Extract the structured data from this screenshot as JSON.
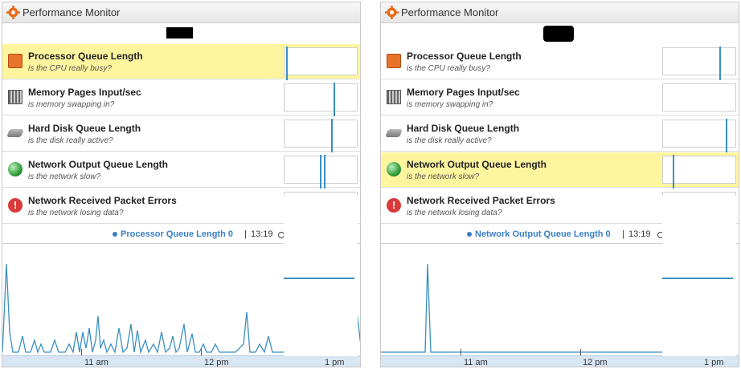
{
  "panels": [
    {
      "title": "Performance Monitor",
      "metrics": [
        {
          "label": "Processor Queue Length",
          "sub": "is the CPU really busy?",
          "icon": "cpu-icon",
          "active": true
        },
        {
          "label": "Memory Pages Input/sec",
          "sub": "is memory swapping in?",
          "icon": "memory-icon",
          "active": false
        },
        {
          "label": "Hard Disk Queue Length",
          "sub": "is the disk really active?",
          "icon": "hard-disk-icon",
          "active": false
        },
        {
          "label": "Network Output Queue Length",
          "sub": "is the network slow?",
          "icon": "network-globe-icon",
          "active": false
        },
        {
          "label": "Network Received Packet Errors",
          "sub": "is the network losing data?",
          "icon": "error-icon",
          "active": false
        }
      ],
      "legend": {
        "series": "Processor Queue Length 0",
        "separator": "|",
        "time": "13:19"
      },
      "x_ticks": [
        "11 am",
        "12 pm",
        "1 pm"
      ]
    },
    {
      "title": "Performance Monitor",
      "metrics": [
        {
          "label": "Processor Queue Length",
          "sub": "is the CPU really busy?",
          "icon": "cpu-icon",
          "active": false
        },
        {
          "label": "Memory Pages Input/sec",
          "sub": "is memory swapping in?",
          "icon": "memory-icon",
          "active": false
        },
        {
          "label": "Hard Disk Queue Length",
          "sub": "is the disk really active?",
          "icon": "hard-disk-icon",
          "active": false
        },
        {
          "label": "Network Output Queue Length",
          "sub": "is the network slow?",
          "icon": "network-globe-icon",
          "active": true
        },
        {
          "label": "Network Received Packet Errors",
          "sub": "is the network losing data?",
          "icon": "error-icon",
          "active": false
        }
      ],
      "legend": {
        "series": "Network Output Queue Length 0",
        "separator": "|",
        "time": "13:19"
      },
      "x_ticks": [
        "11 am",
        "12 pm",
        "1 pm"
      ]
    }
  ],
  "colors": {
    "series": "#3a8fc0",
    "active_row": "#fff59f",
    "legend_text": "#3a7fc4",
    "axis_bar": "#d8e6f4"
  }
}
